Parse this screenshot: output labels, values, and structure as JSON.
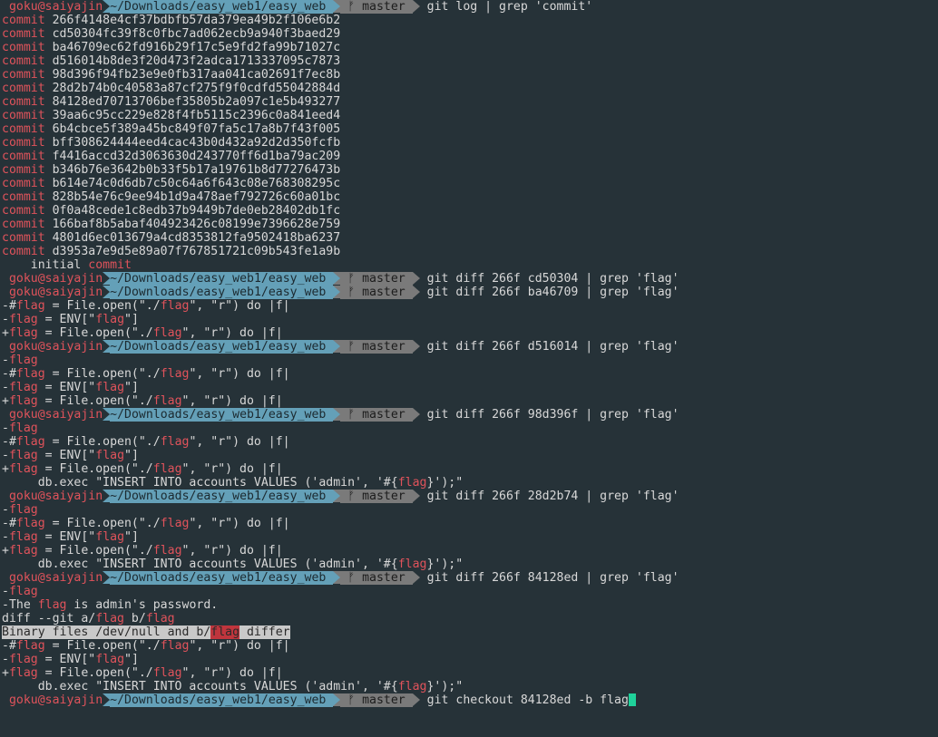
{
  "prompt": {
    "user": "goku@saiyajin",
    "path": "~/Downloads/easy_web1/easy_web",
    "branch_glyph": "ᚠ",
    "branch": "master"
  },
  "commands": {
    "log": "git log | grep 'commit'",
    "diff1": "git diff 266f cd50304 | grep 'flag'",
    "diff2": "git diff 266f ba46709 | grep 'flag'",
    "diff3": "git diff 266f d516014 | grep 'flag'",
    "diff4": "git diff 266f 98d396f | grep 'flag'",
    "diff5": "git diff 266f 28d2b74 | grep 'flag'",
    "diff6": "git diff 266f 84128ed | grep 'flag'",
    "checkout": "git checkout 84128ed -b flag"
  },
  "commit_word": "commit",
  "commits": [
    "266f4148e4cf37bdbfb57da379ea49b2f106e6b2",
    "cd50304fc39f8c0fbc7ad062ecb9a940f3baed29",
    "ba46709ec62fd916b29f17c5e9fd2fa99b71027c",
    "d516014b8de3f20d473f2adca1713337095c7873",
    "98d396f94fb23e9e0fb317aa041ca02691f7ec8b",
    "28d2b74b0c40583a87cf275f9f0cdfd55042884d",
    "84128ed70713706bef35805b2a097c1e5b493277",
    "39aa6c95cc229e828f4fb5115c2396c0a841eed4",
    "6b4cbce5f389a45bc849f07fa5c17a8b7f43f005",
    "bff308624444eed4cac43b0d432a92d2d350fcfb",
    "f4416accd32d3063630d243770ff6d1ba79ac209",
    "b346b76e3642b0b33f5b17a19761b8d77276473b",
    "b614e74c0d6db7c50c64a6f643c08e768308295c",
    "828b54e76c9ee94b1d9a478aef792726c60a01bc",
    "0f0a48cede1c8edb37b9449b7de0eb28402db1fc",
    "166baf8b5abaf404923426c08199e7396628e759",
    "4801d6ec013679a4cd8353812fa9502418ba6237",
    "d3953a7e9d5e89a07f767851721c09b543fe1a9b"
  ],
  "log_tail": {
    "prefix": "    initial ",
    "word": "commit"
  },
  "diff_lines": {
    "hash_open": {
      "a": "-#",
      "b": "flag",
      "c": " = File.open(\"./",
      "d": "flag",
      "e": "\", \"r\") do |f|"
    },
    "env": {
      "a": "-",
      "b": "flag",
      "c": " = ENV[\"",
      "d": "flag",
      "e": "\"]"
    },
    "plus_open": {
      "a": "+",
      "b": "flag",
      "c": " = File.open(\"./",
      "d": "flag",
      "e": "\", \"r\") do |f|"
    },
    "minus_flag": {
      "a": "-",
      "b": "flag"
    },
    "db_exec": {
      "a": "     db.exec \"INSERT INTO accounts VALUES ('admin', '#{",
      "b": "flag",
      "c": "}');\""
    },
    "the_flag": {
      "a": "-The ",
      "b": "flag",
      "c": " is admin's password."
    },
    "diff_git": {
      "a": "diff --git a/",
      "b": "flag",
      "c": " b/",
      "d": "flag"
    },
    "binary": {
      "a": "Binary files /dev/null and b/",
      "b": "flag",
      "c": " differ"
    }
  }
}
